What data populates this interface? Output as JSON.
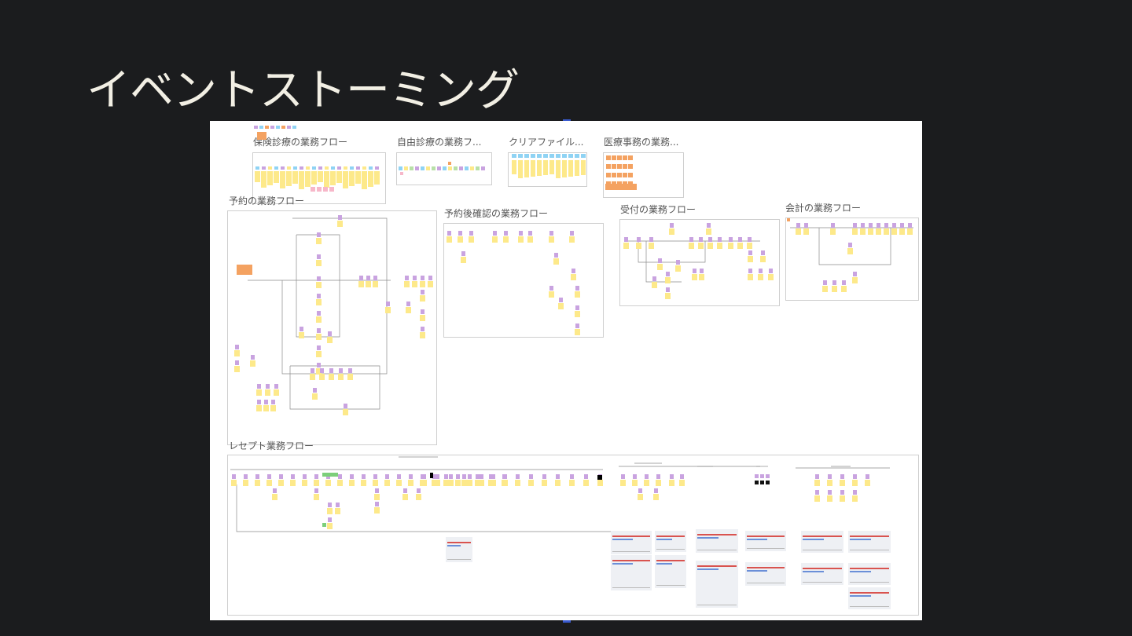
{
  "slide": {
    "title": "イベントストーミング"
  },
  "board": {
    "frames": [
      {
        "id": "hoken",
        "label": "保険診療の業務フロー"
      },
      {
        "id": "jiyu",
        "label": "自由診療の業務フ..."
      },
      {
        "id": "clear",
        "label": "クリアファイル..."
      },
      {
        "id": "iryo",
        "label": "医療事務の業務..."
      },
      {
        "id": "yoyaku",
        "label": "予約の業務フロー"
      },
      {
        "id": "kakunin",
        "label": "予約後確認の業務フロー"
      },
      {
        "id": "uketsuke",
        "label": "受付の業務フロー"
      },
      {
        "id": "kaikei",
        "label": "会計の業務フロー"
      },
      {
        "id": "receipt",
        "label": "レセプト業務フロー"
      }
    ]
  },
  "colors": {
    "slide_background": "#1b1c1e",
    "title": "#f2efe4",
    "board": "#ffffff",
    "sticky_event": "#fde98a",
    "sticky_command": "#c9a3e0",
    "sticky_policy": "#f4a261",
    "sticky_readmodel": "#8fd3f4",
    "sticky_external": "#f7b7c9",
    "sticky_green": "#7ccf7a",
    "connector": "#8a8a8a"
  }
}
